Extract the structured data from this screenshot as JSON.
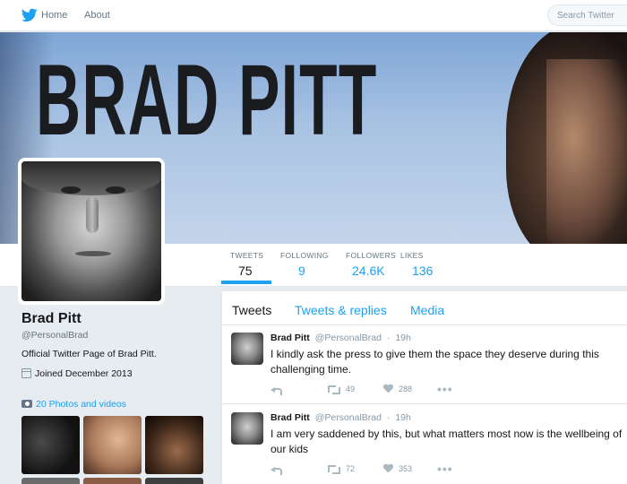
{
  "nav": {
    "home_label": "Home",
    "about_label": "About",
    "search_placeholder": "Search Twitter"
  },
  "banner": {
    "title": "BRAD PITT"
  },
  "stats": {
    "tweets": {
      "label": "TWEETS",
      "value": "75"
    },
    "following": {
      "label": "FOLLOWING",
      "value": "9"
    },
    "followers": {
      "label": "FOLLOWERS",
      "value": "24.6K"
    },
    "likes": {
      "label": "LIKES",
      "value": "136"
    }
  },
  "profile": {
    "name": "Brad Pitt",
    "handle": "@PersonalBrad",
    "bio": "Official Twitter Page of Brad Pitt.",
    "joined": "Joined December 2013",
    "photos_label": "20 Photos and videos"
  },
  "tabs": [
    "Tweets",
    "Tweets & replies",
    "Media"
  ],
  "tweets": [
    {
      "name": "Brad Pitt",
      "handle": "@PersonalBrad",
      "time": "19h",
      "text": "I kindly ask the press to give them the space they deserve during this challenging time.",
      "retweets": "49",
      "likes": "288"
    },
    {
      "name": "Brad Pitt",
      "handle": "@PersonalBrad",
      "time": "19h",
      "text": "I am very saddened by this, but what matters most now is the wellbeing of our kids",
      "retweets": "72",
      "likes": "353"
    }
  ],
  "icons": {
    "logo": "twitter-bird-icon",
    "calendar": "calendar-icon",
    "camera": "camera-icon",
    "reply": "reply-icon",
    "retweet": "retweet-icon",
    "like": "heart-icon",
    "more": "more-icon"
  },
  "colors": {
    "brand_blue": "#1da1f2",
    "background": "#e6ecf0",
    "text": "#14171a",
    "muted": "#66757f"
  }
}
